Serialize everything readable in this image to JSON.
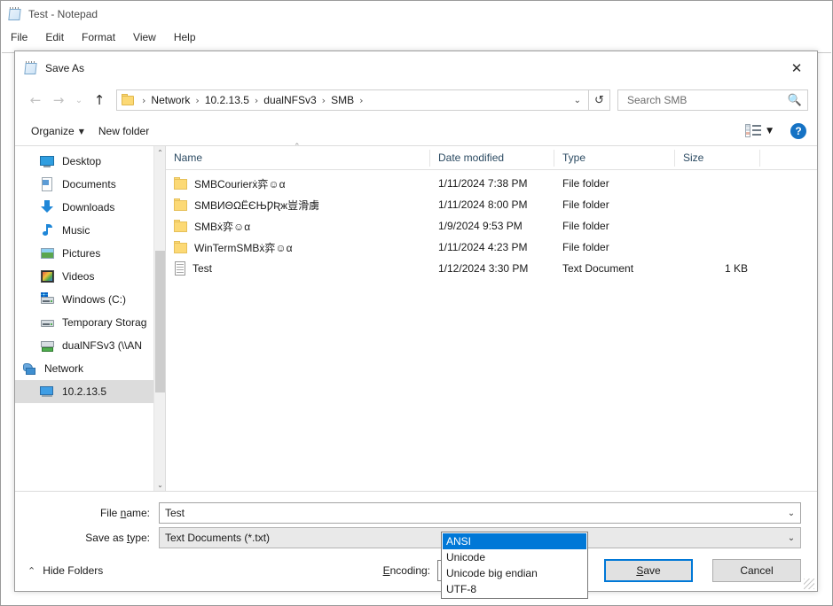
{
  "notepad": {
    "title": "Test - Notepad",
    "icon": "notepad-icon",
    "menu": [
      "File",
      "Edit",
      "Format",
      "View",
      "Help"
    ]
  },
  "dialog": {
    "title": "Save As",
    "icon": "notepad-icon",
    "close_label": "✕",
    "nav": {
      "back_label": "←",
      "forward_label": "→",
      "recent_label": "⌄",
      "up_label": "↑",
      "refresh_label": "↺"
    },
    "breadcrumb": {
      "items": [
        "Network",
        "10.2.13.5",
        "dualNFSv3",
        "SMB"
      ],
      "separator": "›",
      "dropdown_label": "⌄"
    },
    "search": {
      "placeholder": "Search SMB",
      "value": "",
      "icon": "search-icon"
    },
    "command_bar": {
      "organize_label": "Organize",
      "organize_caret": "▼",
      "new_folder_label": "New folder",
      "view_caret": "▼",
      "help_label": "?"
    },
    "sidebar": {
      "scroll_up": "⌃",
      "scroll_down": "⌄",
      "items": [
        {
          "label": "Desktop",
          "icon": "desktop-icon",
          "indent": true,
          "selected": false
        },
        {
          "label": "Documents",
          "icon": "documents-icon",
          "indent": true,
          "selected": false
        },
        {
          "label": "Downloads",
          "icon": "downloads-icon",
          "indent": true,
          "selected": false
        },
        {
          "label": "Music",
          "icon": "music-icon",
          "indent": true,
          "selected": false
        },
        {
          "label": "Pictures",
          "icon": "pictures-icon",
          "indent": true,
          "selected": false
        },
        {
          "label": "Videos",
          "icon": "videos-icon",
          "indent": true,
          "selected": false
        },
        {
          "label": "Windows (C:)",
          "icon": "windows-drive-icon",
          "indent": true,
          "selected": false
        },
        {
          "label": "Temporary Storag",
          "icon": "drive-icon",
          "indent": true,
          "selected": false
        },
        {
          "label": "dualNFSv3 (\\\\AN",
          "icon": "network-drive-icon",
          "indent": true,
          "selected": false
        },
        {
          "label": "Network",
          "icon": "network-icon",
          "indent": false,
          "selected": false
        },
        {
          "label": "10.2.13.5",
          "icon": "computer-icon",
          "indent": true,
          "selected": true
        }
      ]
    },
    "filelist": {
      "sort_indicator": "⌃",
      "columns": [
        "Name",
        "Date modified",
        "Type",
        "Size"
      ],
      "rows": [
        {
          "name": "SMBCourierẋ弈☺α",
          "date": "1/11/2024 7:38 PM",
          "type": "File folder",
          "size": "",
          "icon": "folder-icon"
        },
        {
          "name": "SMBИΘΩЁЄЊǷƦж豈滑虜",
          "date": "1/11/2024 8:00 PM",
          "type": "File folder",
          "size": "",
          "icon": "folder-icon"
        },
        {
          "name": "SMBẋ弈☺α",
          "date": "1/9/2024 9:53 PM",
          "type": "File folder",
          "size": "",
          "icon": "folder-icon"
        },
        {
          "name": "WinTermSMBẋ弈☺α",
          "date": "1/11/2024 4:23 PM",
          "type": "File folder",
          "size": "",
          "icon": "folder-icon"
        },
        {
          "name": "Test",
          "date": "1/12/2024 3:30 PM",
          "type": "Text Document",
          "size": "1 KB",
          "icon": "text-document-icon"
        }
      ]
    },
    "form": {
      "filename_label": "File name:",
      "filename_value": "Test",
      "filetype_label": "Save as type:",
      "filetype_value": "Text Documents (*.txt)",
      "caret": "⌄"
    },
    "actions": {
      "hide_folders_label": "Hide Folders",
      "hide_folders_chevron": "⌃",
      "encoding_label": "Encoding:",
      "encoding_value": "ANSI",
      "encoding_caret": "⌄",
      "encoding_options": [
        "ANSI",
        "Unicode",
        "Unicode big endian",
        "UTF-8"
      ],
      "encoding_selected_index": 0,
      "save_label": "Save",
      "cancel_label": "Cancel"
    }
  },
  "colors": {
    "accent": "#0078d7",
    "selection": "#0078d7",
    "sidebar_selected": "#dcdcdc",
    "folder": "#fcd975",
    "help_blue": "#1572c4"
  }
}
